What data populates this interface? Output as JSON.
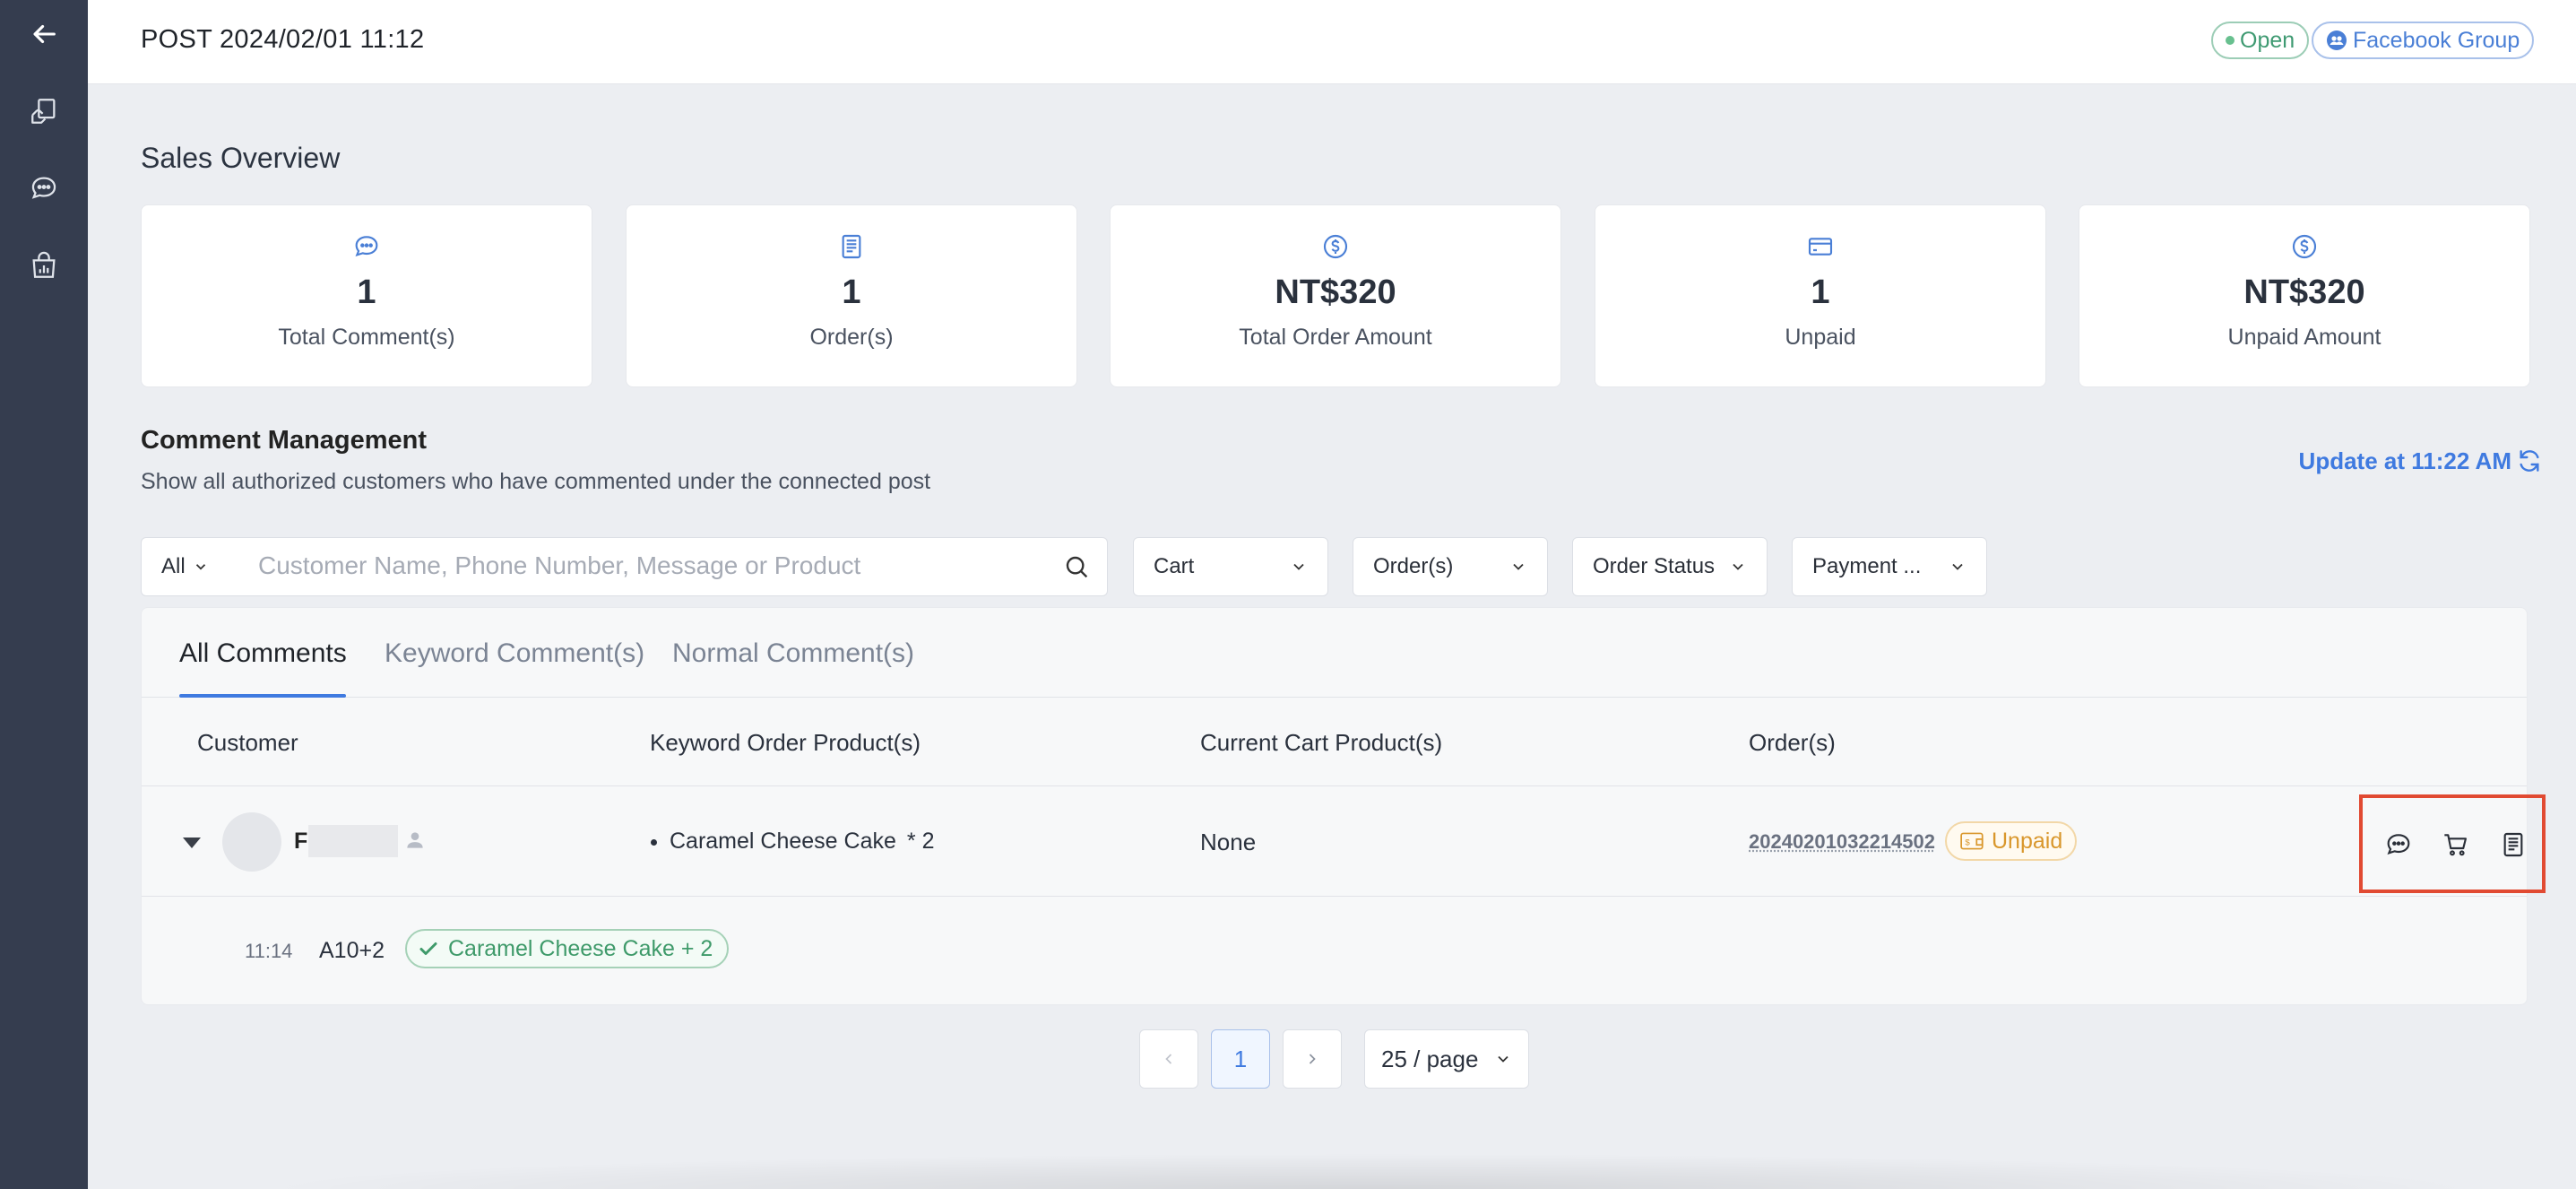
{
  "header": {
    "post_title": "POST 2024/02/01 11:12",
    "status_label": "Open",
    "group_label": "Facebook Group"
  },
  "sidebar": {
    "items": [
      {
        "icon": "back-arrow-icon"
      },
      {
        "icon": "post-hand-icon"
      },
      {
        "icon": "chat-icon"
      },
      {
        "icon": "shop-chart-icon"
      }
    ]
  },
  "overview": {
    "title": "Sales Overview",
    "cards": [
      {
        "icon": "comment-icon",
        "value": "1",
        "label": "Total Comment(s)"
      },
      {
        "icon": "order-doc-icon",
        "value": "1",
        "label": "Order(s)"
      },
      {
        "icon": "dollar-circle-icon",
        "value": "NT$320",
        "label": "Total Order Amount"
      },
      {
        "icon": "credit-card-icon",
        "value": "1",
        "label": "Unpaid"
      },
      {
        "icon": "dollar-circle-icon",
        "value": "NT$320",
        "label": "Unpaid Amount"
      }
    ]
  },
  "comments": {
    "title": "Comment Management",
    "subtitle": "Show all authorized customers who have commented under the connected post",
    "update_label": "Update at 11:22 AM",
    "filters": {
      "scope": "All",
      "search_placeholder": "Customer Name, Phone Number, Message or Product",
      "cart": "Cart",
      "orders": "Order(s)",
      "order_status": "Order Status",
      "payment": "Payment ..."
    },
    "tabs": [
      "All Comments",
      "Keyword Comment(s)",
      "Normal Comment(s)"
    ],
    "columns": [
      "Customer",
      "Keyword Order Product(s)",
      "Current Cart Product(s)",
      "Order(s)"
    ],
    "rows": [
      {
        "customer_initial": "F",
        "product": "Caramel Cheese Cake",
        "product_qty": "* 2",
        "cart": "None",
        "order_no": "20240201032214502",
        "payment_status": "Unpaid",
        "comment": {
          "time": "11:14",
          "message": "A10+2",
          "matched_tag": "Caramel Cheese Cake + 2"
        }
      }
    ]
  },
  "pagination": {
    "current": "1",
    "page_size": "25 / page"
  },
  "colors": {
    "accent": "#3f7ae0",
    "sidebar": "#353d4f",
    "highlight": "#e14a32",
    "unpaid": "#d9972c",
    "success": "#3f9a6a"
  }
}
